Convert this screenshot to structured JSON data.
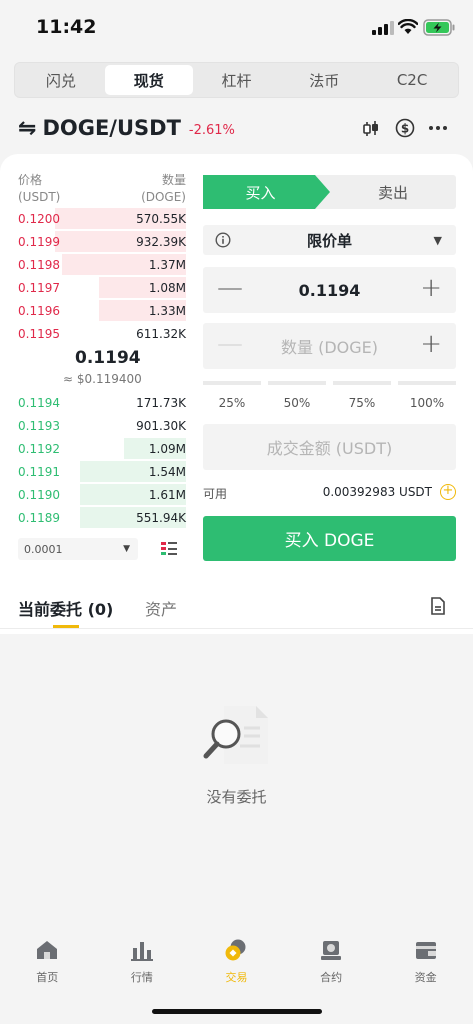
{
  "status_bar": {
    "time": "11:42"
  },
  "top_tabs": [
    "闪兑",
    "现货",
    "杠杆",
    "法币",
    "C2C"
  ],
  "pair": {
    "swap_symbol": "⇋",
    "name": "DOGE/USDT",
    "change": "-2.61%"
  },
  "order_book": {
    "price_label": "价格",
    "price_unit": "(USDT)",
    "qty_label": "数量",
    "qty_unit": "(DOGE)",
    "asks": [
      {
        "price": "0.1200",
        "qty": "570.55K",
        "depth": 0.78
      },
      {
        "price": "0.1199",
        "qty": "932.39K",
        "depth": 0.78
      },
      {
        "price": "0.1198",
        "qty": "1.37M",
        "depth": 0.74
      },
      {
        "price": "0.1197",
        "qty": "1.08M",
        "depth": 0.52
      },
      {
        "price": "0.1196",
        "qty": "1.33M",
        "depth": 0.52
      },
      {
        "price": "0.1195",
        "qty": "611.32K",
        "depth": 0.0
      }
    ],
    "last_price": "0.1194",
    "last_price_usd": "≈ $0.119400",
    "bids": [
      {
        "price": "0.1194",
        "qty": "171.73K",
        "depth": 0.0
      },
      {
        "price": "0.1193",
        "qty": "901.30K",
        "depth": 0.0
      },
      {
        "price": "0.1192",
        "qty": "1.09M",
        "depth": 0.37
      },
      {
        "price": "0.1191",
        "qty": "1.54M",
        "depth": 0.63
      },
      {
        "price": "0.1190",
        "qty": "1.61M",
        "depth": 0.63
      },
      {
        "price": "0.1189",
        "qty": "551.94K",
        "depth": 0.63
      }
    ],
    "precision": "0.0001"
  },
  "trade_form": {
    "buy_tab": "买入",
    "sell_tab": "卖出",
    "order_type": "限价单",
    "price_value": "0.1194",
    "qty_placeholder": "数量 (DOGE)",
    "percentages": [
      "25%",
      "50%",
      "75%",
      "100%"
    ],
    "total_placeholder": "成交金额 (USDT)",
    "available_label": "可用",
    "available_value": "0.00392983 USDT",
    "submit_label": "买入 DOGE"
  },
  "orders": {
    "tab_open": "当前委托 (0)",
    "tab_assets": "资产",
    "empty_text": "没有委托"
  },
  "bottom_nav": [
    {
      "label": "首页",
      "icon": "home-icon"
    },
    {
      "label": "行情",
      "icon": "market-icon"
    },
    {
      "label": "交易",
      "icon": "trade-icon"
    },
    {
      "label": "合约",
      "icon": "futures-icon"
    },
    {
      "label": "资金",
      "icon": "wallet-icon"
    }
  ],
  "colors": {
    "buy": "#2ebd72",
    "sell": "#e0294a",
    "accent": "#f0b90b"
  }
}
